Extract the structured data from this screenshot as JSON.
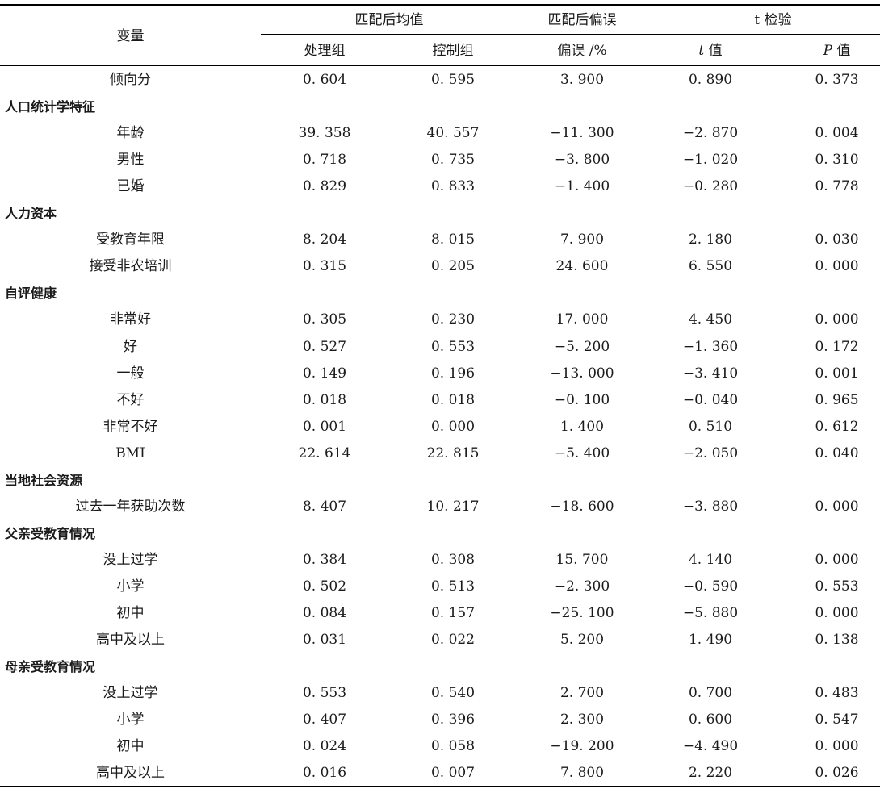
{
  "header": {
    "variable": "变量",
    "groups": {
      "matched_mean": "匹配后均值",
      "matched_bias": "匹配后偏误",
      "ttest": "t 检验"
    },
    "sub": {
      "treated": "处理组",
      "control": "控制组",
      "bias_pct": "偏误 /%",
      "t_sym": "t",
      "t_val": " 值",
      "p_sym": "P",
      "p_val": " 值"
    }
  },
  "rows": [
    {
      "type": "item",
      "label": "倾向分",
      "v": [
        "0. 604",
        "0. 595",
        "3. 900",
        "0. 890",
        "0. 373"
      ]
    },
    {
      "type": "group",
      "label": "人口统计学特征"
    },
    {
      "type": "item",
      "label": "年龄",
      "v": [
        "39. 358",
        "40. 557",
        "−11. 300",
        "−2. 870",
        "0. 004"
      ]
    },
    {
      "type": "item",
      "label": "男性",
      "v": [
        "0. 718",
        "0. 735",
        "−3. 800",
        "−1. 020",
        "0. 310"
      ]
    },
    {
      "type": "item",
      "label": "已婚",
      "v": [
        "0. 829",
        "0. 833",
        "−1. 400",
        "−0. 280",
        "0. 778"
      ]
    },
    {
      "type": "group",
      "label": "人力资本"
    },
    {
      "type": "item",
      "label": "受教育年限",
      "v": [
        "8. 204",
        "8. 015",
        "7. 900",
        "2. 180",
        "0. 030"
      ]
    },
    {
      "type": "item",
      "label": "接受非农培训",
      "v": [
        "0. 315",
        "0. 205",
        "24. 600",
        "6. 550",
        "0. 000"
      ]
    },
    {
      "type": "group",
      "label": "自评健康"
    },
    {
      "type": "item",
      "label": "非常好",
      "v": [
        "0. 305",
        "0. 230",
        "17. 000",
        "4. 450",
        "0. 000"
      ]
    },
    {
      "type": "item",
      "label": "好",
      "v": [
        "0. 527",
        "0. 553",
        "−5. 200",
        "−1. 360",
        "0. 172"
      ]
    },
    {
      "type": "item",
      "label": "一般",
      "v": [
        "0. 149",
        "0. 196",
        "−13. 000",
        "−3. 410",
        "0. 001"
      ]
    },
    {
      "type": "item",
      "label": "不好",
      "v": [
        "0. 018",
        "0. 018",
        "−0. 100",
        "−0. 040",
        "0. 965"
      ]
    },
    {
      "type": "item",
      "label": "非常不好",
      "v": [
        "0. 001",
        "0. 000",
        "1. 400",
        "0. 510",
        "0. 612"
      ]
    },
    {
      "type": "item",
      "label": "BMI",
      "v": [
        "22. 614",
        "22. 815",
        "−5. 400",
        "−2. 050",
        "0. 040"
      ]
    },
    {
      "type": "group",
      "label": "当地社会资源"
    },
    {
      "type": "item",
      "label": "过去一年获助次数",
      "v": [
        "8. 407",
        "10. 217",
        "−18. 600",
        "−3. 880",
        "0. 000"
      ]
    },
    {
      "type": "group",
      "label": "父亲受教育情况"
    },
    {
      "type": "item",
      "label": "没上过学",
      "v": [
        "0. 384",
        "0. 308",
        "15. 700",
        "4. 140",
        "0. 000"
      ]
    },
    {
      "type": "item",
      "label": "小学",
      "v": [
        "0. 502",
        "0. 513",
        "−2. 300",
        "−0. 590",
        "0. 553"
      ]
    },
    {
      "type": "item",
      "label": "初中",
      "v": [
        "0. 084",
        "0. 157",
        "−25. 100",
        "−5. 880",
        "0. 000"
      ]
    },
    {
      "type": "item",
      "label": "高中及以上",
      "v": [
        "0. 031",
        "0. 022",
        "5. 200",
        "1. 490",
        "0. 138"
      ]
    },
    {
      "type": "group",
      "label": "母亲受教育情况"
    },
    {
      "type": "item",
      "label": "没上过学",
      "v": [
        "0. 553",
        "0. 540",
        "2. 700",
        "0. 700",
        "0. 483"
      ]
    },
    {
      "type": "item",
      "label": "小学",
      "v": [
        "0. 407",
        "0. 396",
        "2. 300",
        "0. 600",
        "0. 547"
      ]
    },
    {
      "type": "item",
      "label": "初中",
      "v": [
        "0. 024",
        "0. 058",
        "−19. 200",
        "−4. 490",
        "0. 000"
      ]
    },
    {
      "type": "item",
      "label": "高中及以上",
      "v": [
        "0. 016",
        "0. 007",
        "7. 800",
        "2. 220",
        "0. 026"
      ]
    }
  ]
}
